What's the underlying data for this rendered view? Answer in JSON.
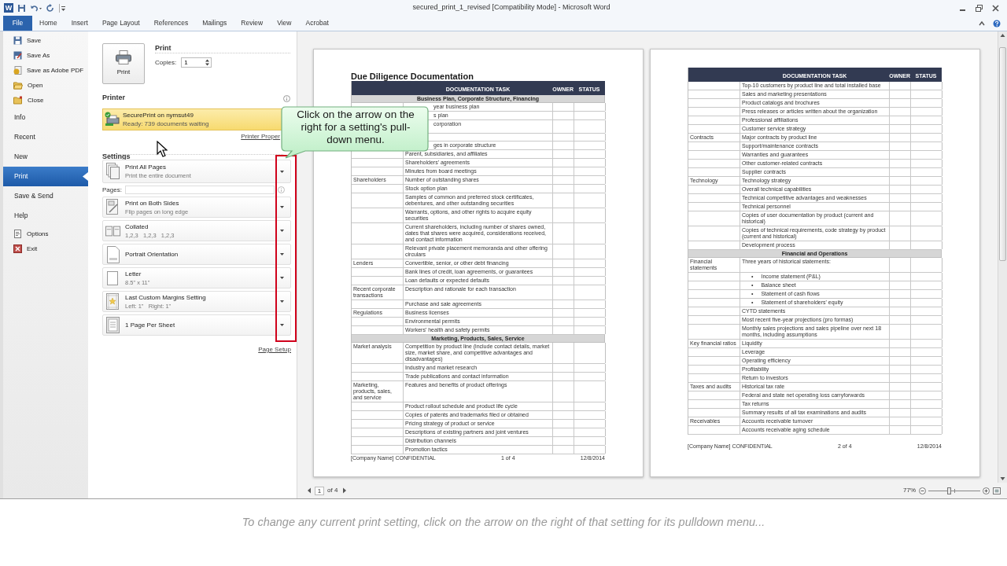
{
  "window": {
    "app_icon": "W",
    "title": "secured_print_1_revised [Compatibility Mode] - Microsoft Word"
  },
  "ribbon_tabs": [
    {
      "label": "File",
      "selected": true
    },
    {
      "label": "Home",
      "selected": false
    },
    {
      "label": "Insert",
      "selected": false
    },
    {
      "label": "Page Layout",
      "selected": false
    },
    {
      "label": "References",
      "selected": false
    },
    {
      "label": "Mailings",
      "selected": false
    },
    {
      "label": "Review",
      "selected": false
    },
    {
      "label": "View",
      "selected": false
    },
    {
      "label": "Acrobat",
      "selected": false
    }
  ],
  "backstage_nav": [
    {
      "label": "Save",
      "kind": "command",
      "selected": false
    },
    {
      "label": "Save As",
      "kind": "command",
      "selected": false
    },
    {
      "label": "Save as Adobe PDF",
      "kind": "command",
      "selected": false
    },
    {
      "label": "Open",
      "kind": "command",
      "selected": false
    },
    {
      "label": "Close",
      "kind": "command",
      "selected": false
    },
    {
      "label": "Info",
      "kind": "tab",
      "selected": false
    },
    {
      "label": "Recent",
      "kind": "tab",
      "selected": false
    },
    {
      "label": "New",
      "kind": "tab",
      "selected": false
    },
    {
      "label": "Print",
      "kind": "tab",
      "selected": true
    },
    {
      "label": "Save & Send",
      "kind": "tab",
      "selected": false
    },
    {
      "label": "Help",
      "kind": "tab",
      "selected": false
    },
    {
      "label": "Options",
      "kind": "command",
      "selected": false
    },
    {
      "label": "Exit",
      "kind": "command",
      "selected": false
    }
  ],
  "print": {
    "heading": "Print",
    "button": "Print",
    "copies_label": "Copies:",
    "copies": "1"
  },
  "printer": {
    "heading": "Printer",
    "name": "SecurePrint on nymsut49",
    "status": "Ready: 739 documents waiting",
    "properties_link": "Printer Proper"
  },
  "settings": {
    "heading": "Settings",
    "items": [
      {
        "kind": "dropdown",
        "title": "Print All Pages",
        "subtitle": "Print the entire document"
      },
      {
        "kind": "pages_field",
        "label": "Pages:"
      },
      {
        "kind": "dropdown",
        "title": "Print on Both Sides",
        "subtitle": "Flip pages on long edge"
      },
      {
        "kind": "dropdown",
        "title": "Collated",
        "subtitle": "1,2,3   1,2,3   1,2,3"
      },
      {
        "kind": "dropdown",
        "title": "Portrait Orientation"
      },
      {
        "kind": "dropdown",
        "title": "Letter",
        "subtitle": "8.5\" x 11\""
      },
      {
        "kind": "dropdown",
        "title": "Last Custom Margins Setting",
        "subtitle": "Left: 1\"   Right: 1\""
      },
      {
        "kind": "dropdown",
        "title": "1 Page Per Sheet"
      }
    ],
    "page_setup_link": "Page Setup"
  },
  "callout": "Click on the arrow on the right for a setting's pull-down menu.",
  "pages": [
    {
      "title": "Due Diligence Documentation",
      "columns": [
        "DOCUMENTATION TASK",
        "OWNER",
        "STATUS"
      ],
      "rows": [
        {
          "kind": "section",
          "text": "Business Plan, Corporate Structure, Financing"
        },
        {
          "kind": "partial",
          "task": "year business plan"
        },
        {
          "kind": "partial",
          "task": "s plan"
        },
        {
          "kind": "partial",
          "task": "corporation",
          "tall": true
        },
        {
          "kind": "partial"
        },
        {
          "kind": "partial",
          "task": "ges in corporate structure"
        },
        {
          "kind": "row",
          "task": "Parent, subsidiaries, and affiliates"
        },
        {
          "kind": "row",
          "task": "Shareholders' agreements"
        },
        {
          "kind": "row",
          "task": "Minutes from board meetings"
        },
        {
          "kind": "row",
          "category": "Shareholders",
          "task": "Number of outstanding shares"
        },
        {
          "kind": "row",
          "task": "Stock option plan"
        },
        {
          "kind": "row",
          "task": "Samples of common and preferred stock certificates, debentures, and other outstanding securities"
        },
        {
          "kind": "row",
          "task": "Warrants, options, and other rights to acquire equity securities"
        },
        {
          "kind": "row",
          "task": "Current shareholders, including number of shares owned, dates that shares were acquired, considerations received, and contact information"
        },
        {
          "kind": "row",
          "task": "Relevant private placement memoranda and other offering circulars"
        },
        {
          "kind": "row",
          "category": "Lenders",
          "task": "Convertible, senior, or other debt financing"
        },
        {
          "kind": "row",
          "task": "Bank lines of credit, loan agreements, or guarantees"
        },
        {
          "kind": "row",
          "task": "Loan defaults or expected defaults"
        },
        {
          "kind": "row",
          "category": "Recent corporate transactions",
          "task": "Description and rationale for each transaction"
        },
        {
          "kind": "row",
          "task": "Purchase and sale agreements"
        },
        {
          "kind": "row",
          "category": "Regulations",
          "task": "Business licenses"
        },
        {
          "kind": "row",
          "task": "Environmental permits"
        },
        {
          "kind": "row",
          "task": "Workers' health and safety permits"
        },
        {
          "kind": "section",
          "text": "Marketing, Products, Sales, Service"
        },
        {
          "kind": "row",
          "category": "Market analysis",
          "task": "Competition by product line (include contact details, market size, market share, and competitive advantages and disadvantages)"
        },
        {
          "kind": "row",
          "task": "Industry and market research"
        },
        {
          "kind": "row",
          "task": "Trade publications and contact information"
        },
        {
          "kind": "row",
          "category": "Marketing, products, sales, and service",
          "task": "Features and benefits of product offerings"
        },
        {
          "kind": "row",
          "task": "Product rollout schedule and product life cycle"
        },
        {
          "kind": "row",
          "task": "Copies of patents and trademarks filed or obtained"
        },
        {
          "kind": "row",
          "task": "Pricing strategy of product or service"
        },
        {
          "kind": "row",
          "task": "Descriptions of existing partners and joint ventures"
        },
        {
          "kind": "row",
          "task": "Distribution channels"
        },
        {
          "kind": "row",
          "task": "Promotion tactics"
        }
      ],
      "footer": {
        "left": "[Company Name] CONFIDENTIAL",
        "center": "1 of 4",
        "right": "12/8/2014"
      }
    },
    {
      "columns": [
        "DOCUMENTATION TASK",
        "OWNER",
        "STATUS"
      ],
      "rows": [
        {
          "kind": "row",
          "task": "Top-10 customers by product line and total installed base"
        },
        {
          "kind": "row",
          "task": "Sales and marketing presentations"
        },
        {
          "kind": "row",
          "task": "Product catalogs and brochures"
        },
        {
          "kind": "row",
          "task": "Press releases or articles written about the organization"
        },
        {
          "kind": "row",
          "task": "Professional affiliations"
        },
        {
          "kind": "row",
          "task": "Customer service strategy"
        },
        {
          "kind": "row",
          "category": "Contracts",
          "task": "Major contracts by product line"
        },
        {
          "kind": "row",
          "task": "Support/maintenance contracts"
        },
        {
          "kind": "row",
          "task": "Warranties and guarantees"
        },
        {
          "kind": "row",
          "task": "Other customer-related contracts"
        },
        {
          "kind": "row",
          "task": "Supplier contracts"
        },
        {
          "kind": "row",
          "category": "Technology",
          "task": "Technology strategy"
        },
        {
          "kind": "row",
          "task": "Overall technical capabilities"
        },
        {
          "kind": "row",
          "task": "Technical competitive advantages and weaknesses"
        },
        {
          "kind": "row",
          "task": "Technical personnel"
        },
        {
          "kind": "row",
          "task": "Copies of user documentation by product (current and historical)"
        },
        {
          "kind": "row",
          "task": "Copies of technical requirements, code strategy by product (current and historical)"
        },
        {
          "kind": "row",
          "task": "Development process"
        },
        {
          "kind": "section",
          "text": "Financial and Operations"
        },
        {
          "kind": "row",
          "category": "Financial statements",
          "task": "Three years of historical statements:"
        },
        {
          "kind": "bullet",
          "marker": "•",
          "task": "Income statement (P&L)"
        },
        {
          "kind": "bullet",
          "marker": "•",
          "task": "Balance sheet"
        },
        {
          "kind": "bullet",
          "marker": "•",
          "task": "Statement of cash flows"
        },
        {
          "kind": "bullet",
          "marker": "•",
          "task": "Statement of shareholders' equity"
        },
        {
          "kind": "row",
          "task": "CYTD statements"
        },
        {
          "kind": "row",
          "task": "Most recent five-year projections (pro formas)"
        },
        {
          "kind": "row",
          "task": "Monthly sales projections and sales pipeline over next 18 months, including assumptions"
        },
        {
          "kind": "row",
          "category": "Key financial ratios",
          "task": "Liquidity"
        },
        {
          "kind": "row",
          "task": "Leverage"
        },
        {
          "kind": "row",
          "task": "Operating efficiency"
        },
        {
          "kind": "row",
          "task": "Profitability"
        },
        {
          "kind": "row",
          "task": "Return to investors"
        },
        {
          "kind": "row",
          "category": "Taxes and audits",
          "task": "Historical tax rate"
        },
        {
          "kind": "row",
          "task": "Federal and state net operating loss carryforwards"
        },
        {
          "kind": "row",
          "task": "Tax returns"
        },
        {
          "kind": "row",
          "task": "Summary results of all tax examinations and audits"
        },
        {
          "kind": "row",
          "category": "Receivables",
          "task": "Accounts receivable turnover"
        },
        {
          "kind": "row",
          "task": "Accounts receivable aging schedule"
        }
      ],
      "footer": {
        "left": "[Company Name] CONFIDENTIAL",
        "center": "2 of 4",
        "right": "12/8/2014"
      }
    }
  ],
  "preview_nav": {
    "page": "1",
    "of": "of 4"
  },
  "zoom": {
    "percent": "77%",
    "level": 0.4
  },
  "caption": "To change any current print setting, click on the arrow on the right of that setting for its pulldown menu..."
}
